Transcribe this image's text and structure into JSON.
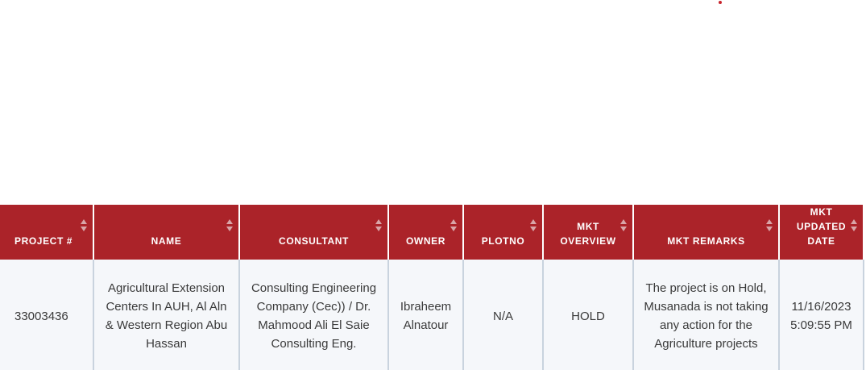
{
  "table": {
    "headers": [
      {
        "lines": [
          "PROJECT #"
        ]
      },
      {
        "lines": [
          "NAME"
        ]
      },
      {
        "lines": [
          "CONSULTANT"
        ]
      },
      {
        "lines": [
          "OWNER"
        ]
      },
      {
        "lines": [
          "PLOTNO"
        ]
      },
      {
        "lines": [
          "MKT",
          "OVERVIEW"
        ]
      },
      {
        "lines": [
          "MKT REMARKS"
        ]
      },
      {
        "lines": [
          "MKT",
          "UPDATED",
          "DATE"
        ]
      }
    ],
    "rows": [
      {
        "project_no": "33003436",
        "name": "Agricultural Extension Centers In AUH, Al Aln & Western Region Abu Hassan",
        "consultant": "Consulting Engineering Company (Cec)) / Dr. Mahmood Ali El Saie Consulting Eng.",
        "owner": "Ibraheem Alnatour",
        "plotno": "N/A",
        "mkt_overview": "HOLD",
        "mkt_remarks": "The project is on Hold, Musanada is not taking any action for the Agriculture projects",
        "mkt_updated_date": "11/16/2023 5:09:55 PM"
      }
    ]
  },
  "colors": {
    "header_bg": "#ab2329",
    "row_bg": "#f5f7fa",
    "accent_dot": "#c8242c"
  }
}
